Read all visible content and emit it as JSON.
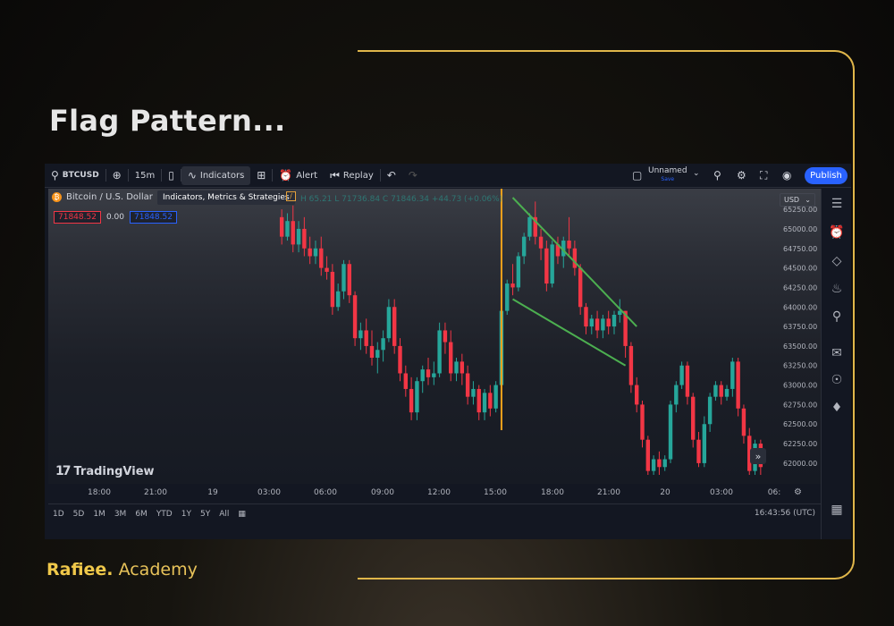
{
  "slide": {
    "title": "Flag Pattern...",
    "brand_bold": "Rafiee.",
    "brand_rest": " Academy",
    "frame_color": "#e0b64a"
  },
  "toolbar": {
    "symbol": "BTCUSD",
    "interval": "15m",
    "indicators_label": "Indicators",
    "alert_label": "Alert",
    "replay_label": "Replay",
    "layout_name": "Unnamed",
    "layout_sub": "Save",
    "publish_label": "Publish",
    "icons": [
      "search-icon",
      "plus-circle-icon",
      "candles-icon",
      "indicators-icon",
      "templates-icon",
      "alert-icon",
      "replay-icon",
      "undo-icon",
      "redo-icon",
      "layout-icon",
      "quick-search-icon",
      "settings-icon",
      "fullscreen-icon",
      "camera-icon"
    ]
  },
  "legend": {
    "pair": "Bitcoin / U.S. Dollar",
    "tooltip": "Indicators, Metrics & Strategies",
    "ohlc": "H 65.21  L 71736.84  C 71846.34  +44.73 (+0.06%)",
    "sell_price": "71848.52",
    "spread": "0.00",
    "buy_price": "71848.52",
    "currency": "USD"
  },
  "logo_text": "TradingView",
  "time_ticks": [
    "18:00",
    "21:00",
    "19",
    "03:00",
    "06:00",
    "09:00",
    "12:00",
    "15:00",
    "18:00",
    "21:00",
    "20",
    "03:00",
    "06:"
  ],
  "bottom_bar": {
    "ranges": [
      "1D",
      "5D",
      "1M",
      "3M",
      "6M",
      "YTD",
      "1Y",
      "5Y",
      "All"
    ],
    "clock": "16:43:56 (UTC)"
  },
  "colors": {
    "up": "#26a69a",
    "down": "#f23645",
    "flag_lines": "#4caf50",
    "pole_line": "#f7a21b",
    "accent": "#2962ff"
  },
  "chart_data": {
    "type": "candlestick",
    "title": "",
    "xlabel": "",
    "ylabel": "",
    "ylim": [
      61850,
      65400
    ],
    "y_ticks": [
      65250,
      65000,
      64750,
      64500,
      64250,
      64000,
      63750,
      63500,
      63250,
      63000,
      62750,
      62500,
      62250,
      62000
    ],
    "y_tick_labels": [
      "65250.00",
      "65000.00",
      "64750.00",
      "64500.00",
      "64250.00",
      "64000.00",
      "63750.00",
      "63500.00",
      "63250.00",
      "63000.00",
      "62750.00",
      "62500.00",
      "62250.00",
      "62000.00"
    ],
    "candles": [
      {
        "o": 65150,
        "h": 65250,
        "c": 64900,
        "l": 64800
      },
      {
        "o": 64900,
        "h": 65200,
        "c": 65100,
        "l": 64850
      },
      {
        "o": 65100,
        "h": 65300,
        "c": 64800,
        "l": 64700
      },
      {
        "o": 64800,
        "h": 65100,
        "c": 65000,
        "l": 64700
      },
      {
        "o": 65000,
        "h": 65150,
        "c": 64750,
        "l": 64650
      },
      {
        "o": 64750,
        "h": 64900,
        "c": 64650,
        "l": 64550
      },
      {
        "o": 64650,
        "h": 64850,
        "c": 64750,
        "l": 64550
      },
      {
        "o": 64750,
        "h": 64900,
        "c": 64500,
        "l": 64400
      },
      {
        "o": 64500,
        "h": 64650,
        "c": 64450,
        "l": 64350
      },
      {
        "o": 64450,
        "h": 64550,
        "c": 64000,
        "l": 63900
      },
      {
        "o": 64000,
        "h": 64300,
        "c": 64200,
        "l": 63950
      },
      {
        "o": 64200,
        "h": 64600,
        "c": 64550,
        "l": 64100
      },
      {
        "o": 64550,
        "h": 64600,
        "c": 64150,
        "l": 64050
      },
      {
        "o": 64150,
        "h": 64200,
        "c": 63600,
        "l": 63500
      },
      {
        "o": 63600,
        "h": 63800,
        "c": 63700,
        "l": 63450
      },
      {
        "o": 63700,
        "h": 63850,
        "c": 63500,
        "l": 63400
      },
      {
        "o": 63500,
        "h": 63700,
        "c": 63350,
        "l": 63250
      },
      {
        "o": 63350,
        "h": 63550,
        "c": 63450,
        "l": 63150
      },
      {
        "o": 63450,
        "h": 63700,
        "c": 63600,
        "l": 63300
      },
      {
        "o": 63600,
        "h": 64100,
        "c": 64000,
        "l": 63550
      },
      {
        "o": 64000,
        "h": 64100,
        "c": 63500,
        "l": 63400
      },
      {
        "o": 63500,
        "h": 63600,
        "c": 63150,
        "l": 63050
      },
      {
        "o": 63150,
        "h": 63250,
        "c": 62950,
        "l": 62850
      },
      {
        "o": 62950,
        "h": 63100,
        "c": 62650,
        "l": 62550
      },
      {
        "o": 62650,
        "h": 63100,
        "c": 63050,
        "l": 62550
      },
      {
        "o": 63050,
        "h": 63250,
        "c": 63200,
        "l": 62900
      },
      {
        "o": 63200,
        "h": 63350,
        "c": 63100,
        "l": 63000
      },
      {
        "o": 63100,
        "h": 63300,
        "c": 63150,
        "l": 63000
      },
      {
        "o": 63150,
        "h": 63800,
        "c": 63700,
        "l": 63100
      },
      {
        "o": 63700,
        "h": 63800,
        "c": 63550,
        "l": 63400
      },
      {
        "o": 63550,
        "h": 63700,
        "c": 63150,
        "l": 63050
      },
      {
        "o": 63150,
        "h": 63350,
        "c": 63300,
        "l": 63050
      },
      {
        "o": 63300,
        "h": 63400,
        "c": 63150,
        "l": 63000
      },
      {
        "o": 63150,
        "h": 63250,
        "c": 62850,
        "l": 62750
      },
      {
        "o": 62850,
        "h": 63050,
        "c": 62950,
        "l": 62750
      },
      {
        "o": 62950,
        "h": 63000,
        "c": 62650,
        "l": 62550
      },
      {
        "o": 62650,
        "h": 62950,
        "c": 62900,
        "l": 62550
      },
      {
        "o": 62900,
        "h": 63000,
        "c": 62700,
        "l": 62600
      },
      {
        "o": 62700,
        "h": 63050,
        "c": 63000,
        "l": 62650
      },
      {
        "o": 63000,
        "h": 64000,
        "c": 63950,
        "l": 62950
      },
      {
        "o": 63950,
        "h": 64350,
        "c": 64300,
        "l": 63900
      },
      {
        "o": 64300,
        "h": 64550,
        "c": 64250,
        "l": 64150
      },
      {
        "o": 64250,
        "h": 64700,
        "c": 64650,
        "l": 64200
      },
      {
        "o": 64650,
        "h": 64950,
        "c": 64900,
        "l": 64550
      },
      {
        "o": 64900,
        "h": 65200,
        "c": 65150,
        "l": 64850
      },
      {
        "o": 65150,
        "h": 65350,
        "c": 64900,
        "l": 64800
      },
      {
        "o": 64900,
        "h": 65000,
        "c": 64750,
        "l": 64600
      },
      {
        "o": 64750,
        "h": 64850,
        "c": 64300,
        "l": 64200
      },
      {
        "o": 64300,
        "h": 64850,
        "c": 64800,
        "l": 64250
      },
      {
        "o": 64800,
        "h": 64900,
        "c": 64650,
        "l": 64550
      },
      {
        "o": 64650,
        "h": 64900,
        "c": 64850,
        "l": 64500
      },
      {
        "o": 64850,
        "h": 65150,
        "c": 64750,
        "l": 64650
      },
      {
        "o": 64750,
        "h": 64850,
        "c": 64500,
        "l": 64400
      },
      {
        "o": 64500,
        "h": 64550,
        "c": 64000,
        "l": 63900
      },
      {
        "o": 64000,
        "h": 64050,
        "c": 63750,
        "l": 63650
      },
      {
        "o": 63750,
        "h": 63900,
        "c": 63850,
        "l": 63650
      },
      {
        "o": 63850,
        "h": 63950,
        "c": 63700,
        "l": 63600
      },
      {
        "o": 63700,
        "h": 63900,
        "c": 63850,
        "l": 63600
      },
      {
        "o": 63850,
        "h": 63950,
        "c": 63750,
        "l": 63650
      },
      {
        "o": 63750,
        "h": 63950,
        "c": 63900,
        "l": 63650
      },
      {
        "o": 63900,
        "h": 64100,
        "c": 63950,
        "l": 63800
      },
      {
        "o": 63950,
        "h": 63950,
        "c": 63500,
        "l": 63350
      },
      {
        "o": 63500,
        "h": 63550,
        "c": 63000,
        "l": 62900
      },
      {
        "o": 63000,
        "h": 63100,
        "c": 62750,
        "l": 62650
      },
      {
        "o": 62750,
        "h": 62800,
        "c": 62300,
        "l": 62200
      },
      {
        "o": 62300,
        "h": 62350,
        "c": 61900,
        "l": 61850
      },
      {
        "o": 61900,
        "h": 62100,
        "c": 62050,
        "l": 61850
      },
      {
        "o": 62050,
        "h": 62150,
        "c": 61950,
        "l": 61850
      },
      {
        "o": 61950,
        "h": 62100,
        "c": 62050,
        "l": 61900
      },
      {
        "o": 62050,
        "h": 62800,
        "c": 62750,
        "l": 62000
      },
      {
        "o": 62750,
        "h": 63050,
        "c": 63000,
        "l": 62650
      },
      {
        "o": 63000,
        "h": 63300,
        "c": 63250,
        "l": 62950
      },
      {
        "o": 63250,
        "h": 63300,
        "c": 62850,
        "l": 62750
      },
      {
        "o": 62850,
        "h": 62900,
        "c": 62300,
        "l": 62200
      },
      {
        "o": 62300,
        "h": 62400,
        "c": 62000,
        "l": 61950
      },
      {
        "o": 62000,
        "h": 62600,
        "c": 62500,
        "l": 61950
      },
      {
        "o": 62500,
        "h": 62900,
        "c": 62850,
        "l": 62400
      },
      {
        "o": 62850,
        "h": 63050,
        "c": 63000,
        "l": 62800
      },
      {
        "o": 63000,
        "h": 63050,
        "c": 62850,
        "l": 62750
      },
      {
        "o": 62850,
        "h": 63000,
        "c": 62950,
        "l": 62800
      },
      {
        "o": 62950,
        "h": 63350,
        "c": 63300,
        "l": 62850
      },
      {
        "o": 63300,
        "h": 63350,
        "c": 62700,
        "l": 62600
      },
      {
        "o": 62700,
        "h": 62750,
        "c": 62350,
        "l": 62250
      },
      {
        "o": 62350,
        "h": 62450,
        "c": 61900,
        "l": 61850
      },
      {
        "o": 61900,
        "h": 62300,
        "c": 62250,
        "l": 61850
      },
      {
        "o": 62250,
        "h": 62300,
        "c": 61950,
        "l": 61850
      }
    ],
    "pole_marker": {
      "x_index": 39.5
    },
    "flag_lines": [
      {
        "x1_index": 41,
        "y1": 65400,
        "x2_index": 63,
        "y2": 63750
      },
      {
        "x1_index": 41,
        "y1": 64100,
        "x2_index": 61,
        "y2": 63250
      }
    ]
  }
}
